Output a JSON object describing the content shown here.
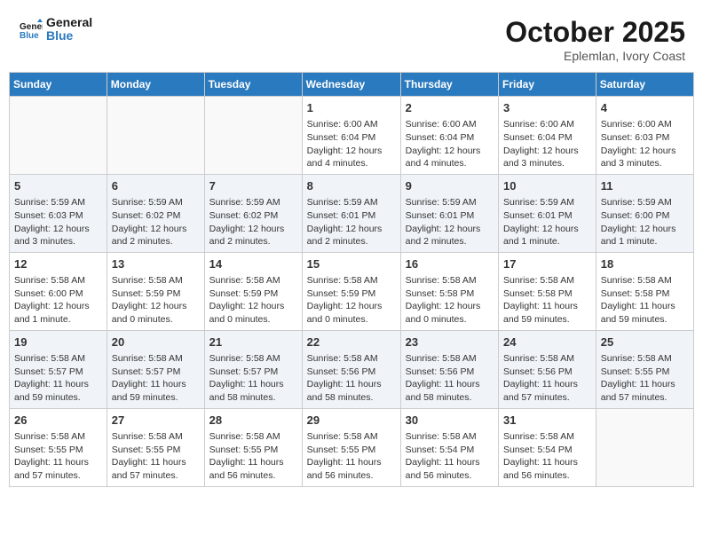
{
  "header": {
    "logo_line1": "General",
    "logo_line2": "Blue",
    "month": "October 2025",
    "location": "Eplemlan, Ivory Coast"
  },
  "weekdays": [
    "Sunday",
    "Monday",
    "Tuesday",
    "Wednesday",
    "Thursday",
    "Friday",
    "Saturday"
  ],
  "weeks": [
    [
      {
        "day": "",
        "info": ""
      },
      {
        "day": "",
        "info": ""
      },
      {
        "day": "",
        "info": ""
      },
      {
        "day": "1",
        "info": "Sunrise: 6:00 AM\nSunset: 6:04 PM\nDaylight: 12 hours\nand 4 minutes."
      },
      {
        "day": "2",
        "info": "Sunrise: 6:00 AM\nSunset: 6:04 PM\nDaylight: 12 hours\nand 4 minutes."
      },
      {
        "day": "3",
        "info": "Sunrise: 6:00 AM\nSunset: 6:04 PM\nDaylight: 12 hours\nand 3 minutes."
      },
      {
        "day": "4",
        "info": "Sunrise: 6:00 AM\nSunset: 6:03 PM\nDaylight: 12 hours\nand 3 minutes."
      }
    ],
    [
      {
        "day": "5",
        "info": "Sunrise: 5:59 AM\nSunset: 6:03 PM\nDaylight: 12 hours\nand 3 minutes."
      },
      {
        "day": "6",
        "info": "Sunrise: 5:59 AM\nSunset: 6:02 PM\nDaylight: 12 hours\nand 2 minutes."
      },
      {
        "day": "7",
        "info": "Sunrise: 5:59 AM\nSunset: 6:02 PM\nDaylight: 12 hours\nand 2 minutes."
      },
      {
        "day": "8",
        "info": "Sunrise: 5:59 AM\nSunset: 6:01 PM\nDaylight: 12 hours\nand 2 minutes."
      },
      {
        "day": "9",
        "info": "Sunrise: 5:59 AM\nSunset: 6:01 PM\nDaylight: 12 hours\nand 2 minutes."
      },
      {
        "day": "10",
        "info": "Sunrise: 5:59 AM\nSunset: 6:01 PM\nDaylight: 12 hours\nand 1 minute."
      },
      {
        "day": "11",
        "info": "Sunrise: 5:59 AM\nSunset: 6:00 PM\nDaylight: 12 hours\nand 1 minute."
      }
    ],
    [
      {
        "day": "12",
        "info": "Sunrise: 5:58 AM\nSunset: 6:00 PM\nDaylight: 12 hours\nand 1 minute."
      },
      {
        "day": "13",
        "info": "Sunrise: 5:58 AM\nSunset: 5:59 PM\nDaylight: 12 hours\nand 0 minutes."
      },
      {
        "day": "14",
        "info": "Sunrise: 5:58 AM\nSunset: 5:59 PM\nDaylight: 12 hours\nand 0 minutes."
      },
      {
        "day": "15",
        "info": "Sunrise: 5:58 AM\nSunset: 5:59 PM\nDaylight: 12 hours\nand 0 minutes."
      },
      {
        "day": "16",
        "info": "Sunrise: 5:58 AM\nSunset: 5:58 PM\nDaylight: 12 hours\nand 0 minutes."
      },
      {
        "day": "17",
        "info": "Sunrise: 5:58 AM\nSunset: 5:58 PM\nDaylight: 11 hours\nand 59 minutes."
      },
      {
        "day": "18",
        "info": "Sunrise: 5:58 AM\nSunset: 5:58 PM\nDaylight: 11 hours\nand 59 minutes."
      }
    ],
    [
      {
        "day": "19",
        "info": "Sunrise: 5:58 AM\nSunset: 5:57 PM\nDaylight: 11 hours\nand 59 minutes."
      },
      {
        "day": "20",
        "info": "Sunrise: 5:58 AM\nSunset: 5:57 PM\nDaylight: 11 hours\nand 59 minutes."
      },
      {
        "day": "21",
        "info": "Sunrise: 5:58 AM\nSunset: 5:57 PM\nDaylight: 11 hours\nand 58 minutes."
      },
      {
        "day": "22",
        "info": "Sunrise: 5:58 AM\nSunset: 5:56 PM\nDaylight: 11 hours\nand 58 minutes."
      },
      {
        "day": "23",
        "info": "Sunrise: 5:58 AM\nSunset: 5:56 PM\nDaylight: 11 hours\nand 58 minutes."
      },
      {
        "day": "24",
        "info": "Sunrise: 5:58 AM\nSunset: 5:56 PM\nDaylight: 11 hours\nand 57 minutes."
      },
      {
        "day": "25",
        "info": "Sunrise: 5:58 AM\nSunset: 5:55 PM\nDaylight: 11 hours\nand 57 minutes."
      }
    ],
    [
      {
        "day": "26",
        "info": "Sunrise: 5:58 AM\nSunset: 5:55 PM\nDaylight: 11 hours\nand 57 minutes."
      },
      {
        "day": "27",
        "info": "Sunrise: 5:58 AM\nSunset: 5:55 PM\nDaylight: 11 hours\nand 57 minutes."
      },
      {
        "day": "28",
        "info": "Sunrise: 5:58 AM\nSunset: 5:55 PM\nDaylight: 11 hours\nand 56 minutes."
      },
      {
        "day": "29",
        "info": "Sunrise: 5:58 AM\nSunset: 5:55 PM\nDaylight: 11 hours\nand 56 minutes."
      },
      {
        "day": "30",
        "info": "Sunrise: 5:58 AM\nSunset: 5:54 PM\nDaylight: 11 hours\nand 56 minutes."
      },
      {
        "day": "31",
        "info": "Sunrise: 5:58 AM\nSunset: 5:54 PM\nDaylight: 11 hours\nand 56 minutes."
      },
      {
        "day": "",
        "info": ""
      }
    ]
  ]
}
